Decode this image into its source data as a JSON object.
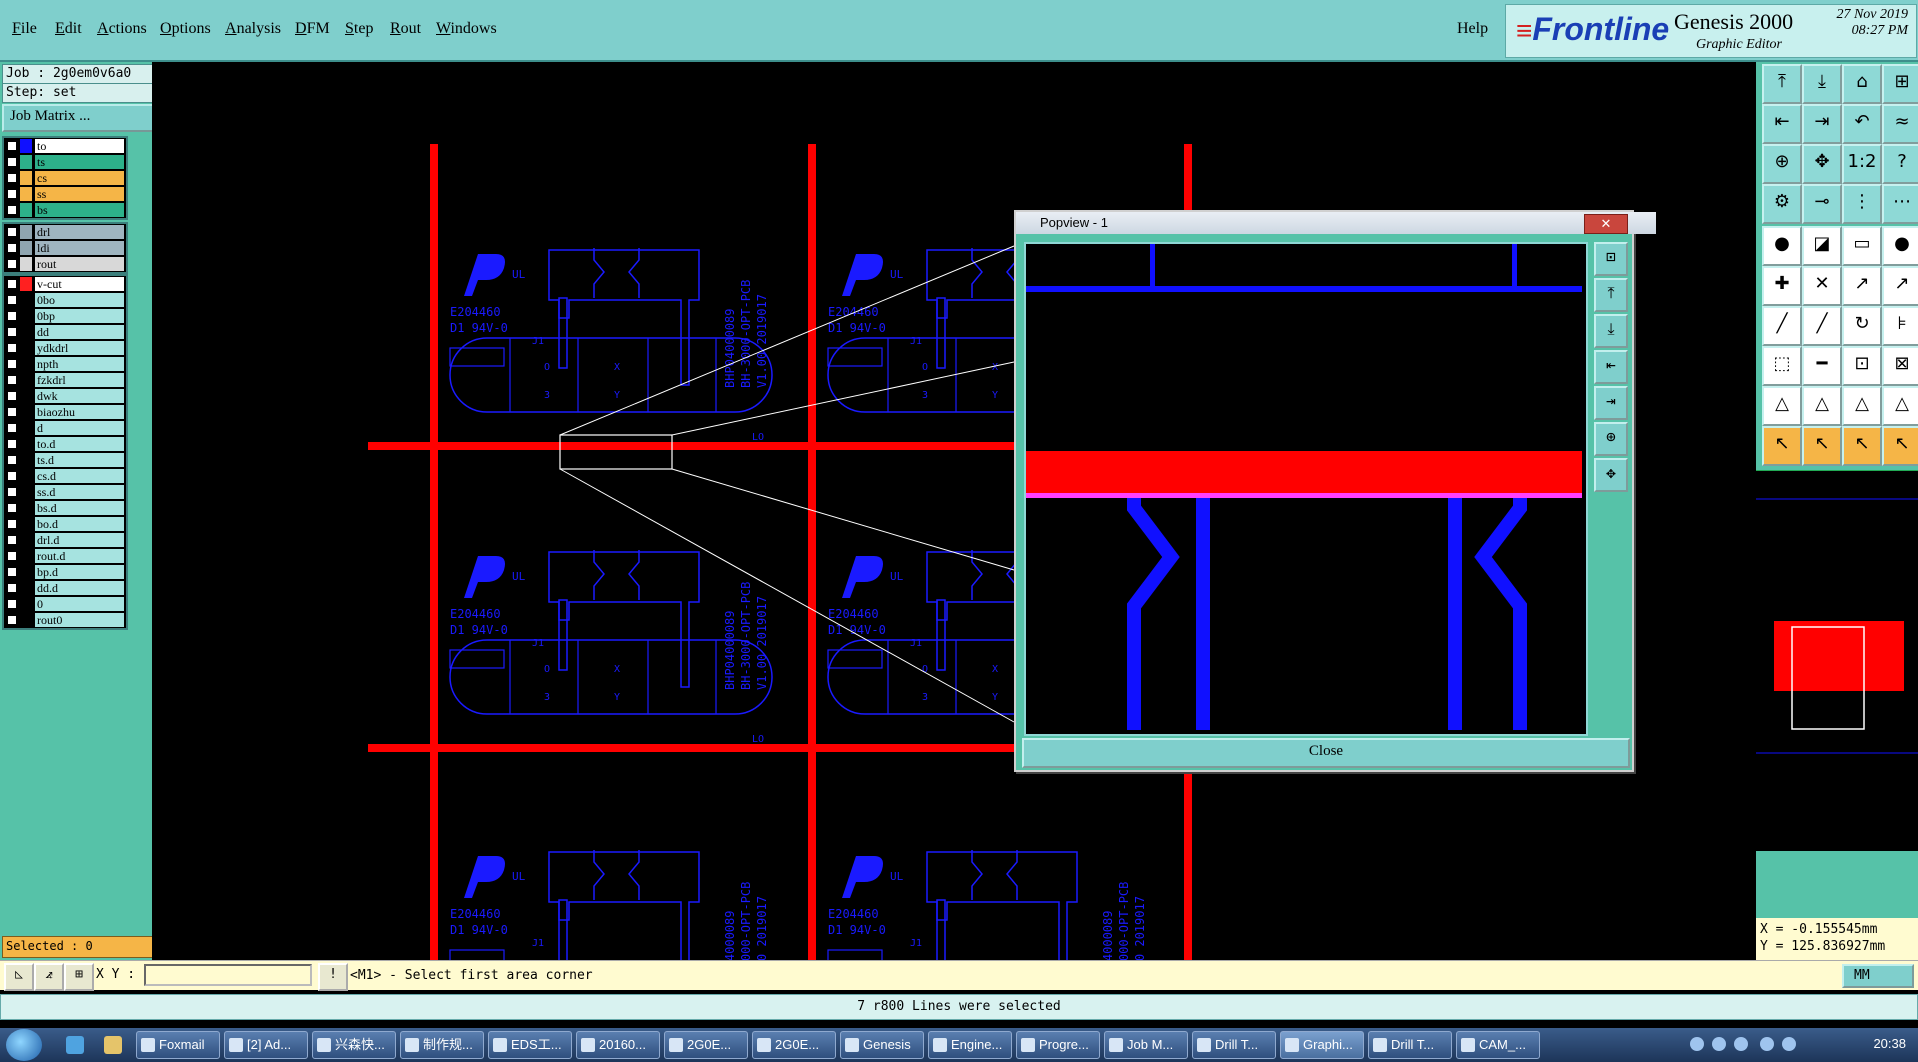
{
  "menubar": {
    "items": [
      "File",
      "Edit",
      "Actions",
      "Options",
      "Analysis",
      "DFM",
      "Step",
      "Rout",
      "Windows"
    ],
    "help": "Help"
  },
  "brand": {
    "logo": "Frontline",
    "product": "Genesis 2000",
    "subtitle": "Graphic Editor",
    "date": "27 Nov 2019",
    "time": "08:27 PM"
  },
  "leftpanel": {
    "job": "Job : 2g0em0v6a0",
    "step": "Step: set",
    "job_matrix": "Job Matrix ...",
    "selected": "Selected : 0",
    "board_layers": [
      {
        "name": "to",
        "color": "#1010ff",
        "bg": "#ffffff"
      },
      {
        "name": "ts",
        "color": "#2db18a",
        "bg": "#2db18a"
      },
      {
        "name": "cs",
        "color": "#f5b547",
        "bg": "#f5b547"
      },
      {
        "name": "ss",
        "color": "#f5b547",
        "bg": "#f5b547"
      },
      {
        "name": "bs",
        "color": "#2db18a",
        "bg": "#2db18a"
      }
    ],
    "drill_layers": [
      {
        "name": "drl",
        "color": "#8fa5b0",
        "bg": "#9fb5c0"
      },
      {
        "name": "ldi",
        "color": "#8fa5b0",
        "bg": "#9fb5c0"
      },
      {
        "name": "rout",
        "color": "#d8d8d8",
        "bg": "#d8d8d8"
      }
    ],
    "misc_layers": [
      {
        "name": "v-cut",
        "color": "#ff2020",
        "bg": "#ffffff"
      },
      {
        "name": "0bo",
        "color": "#000",
        "bg": "#a6e3e0"
      },
      {
        "name": "0bp",
        "color": "#000",
        "bg": "#a6e3e0"
      },
      {
        "name": "dd",
        "color": "#000",
        "bg": "#a6e3e0"
      },
      {
        "name": "ydkdrl",
        "color": "#000",
        "bg": "#a6e3e0"
      },
      {
        "name": "npth",
        "color": "#000",
        "bg": "#a6e3e0"
      },
      {
        "name": "fzkdrl",
        "color": "#000",
        "bg": "#a6e3e0"
      },
      {
        "name": "dwk",
        "color": "#000",
        "bg": "#a6e3e0"
      },
      {
        "name": "biaozhu",
        "color": "#000",
        "bg": "#a6e3e0"
      },
      {
        "name": "d",
        "color": "#000",
        "bg": "#a6e3e0"
      },
      {
        "name": "to.d",
        "color": "#000",
        "bg": "#a6e3e0"
      },
      {
        "name": "ts.d",
        "color": "#000",
        "bg": "#a6e3e0"
      },
      {
        "name": "cs.d",
        "color": "#000",
        "bg": "#a6e3e0"
      },
      {
        "name": "ss.d",
        "color": "#000",
        "bg": "#a6e3e0"
      },
      {
        "name": "bs.d",
        "color": "#000",
        "bg": "#a6e3e0"
      },
      {
        "name": "bo.d",
        "color": "#000",
        "bg": "#a6e3e0"
      },
      {
        "name": "drl.d",
        "color": "#000",
        "bg": "#a6e3e0"
      },
      {
        "name": "rout.d",
        "color": "#000",
        "bg": "#a6e3e0"
      },
      {
        "name": "bp.d",
        "color": "#000",
        "bg": "#a6e3e0"
      },
      {
        "name": "dd.d",
        "color": "#000",
        "bg": "#a6e3e0"
      },
      {
        "name": "0",
        "color": "#000",
        "bg": "#a6e3e0"
      },
      {
        "name": "rout0",
        "color": "#000",
        "bg": "#a6e3e0"
      }
    ]
  },
  "canvas": {
    "board_cells": [
      {
        "cert": "E204460",
        "rating": "D1 94V-0",
        "ref": "J1",
        "vtext1": "BHP04000089",
        "vtext2": "BH-3000-OPT-PCB",
        "vtext3": "V1.00 2019017"
      }
    ],
    "lo_label": "LO",
    "pad_x": "X",
    "pad_y": "Y",
    "pad_o": "O",
    "pad_3": "3"
  },
  "popup": {
    "title": "Popview - 1",
    "close_x": "✕",
    "close_label": "Close"
  },
  "rightbar": {
    "coords_x": "X = -0.155545mm",
    "coords_y": "Y = 125.836927mm",
    "tool_rows": [
      [
        "⤒",
        "⤓",
        "⌂",
        "⊞"
      ],
      [
        "⇤",
        "⇥",
        "↶",
        "≈"
      ],
      [
        "⊕",
        "✥",
        "1:2",
        "?"
      ],
      [
        "⚙",
        "⊸",
        "⋮",
        "⋯"
      ]
    ],
    "white_rows": [
      [
        "●",
        "◪",
        "▭",
        "●"
      ],
      [
        "✚",
        "✕",
        "↗",
        "↗"
      ],
      [
        "╱",
        "╱",
        "↻",
        "⊧"
      ],
      [
        "⬚",
        "━",
        "⊡",
        "⊠"
      ]
    ],
    "shape_row": [
      "△",
      "△",
      "△",
      "△"
    ],
    "pointer_row": [
      "↖",
      "↖",
      "↖",
      "↖"
    ]
  },
  "cmdbar": {
    "xy_label": "X Y :",
    "prompt": "<M1> - Select first area corner",
    "units": "MM"
  },
  "status": "7 r800 Lines were selected",
  "taskbar": {
    "tasks": [
      "Foxmail",
      "[2] Ad...",
      "兴森快...",
      "制作规...",
      "EDS工...",
      "20160...",
      "2G0E...",
      "2G0E...",
      "Genesis",
      "Engine...",
      "Progre...",
      "Job M...",
      "Drill T...",
      "Graphi...",
      "Drill T...",
      "CAM_..."
    ],
    "active": "Graphi...",
    "clock": "20:38"
  }
}
